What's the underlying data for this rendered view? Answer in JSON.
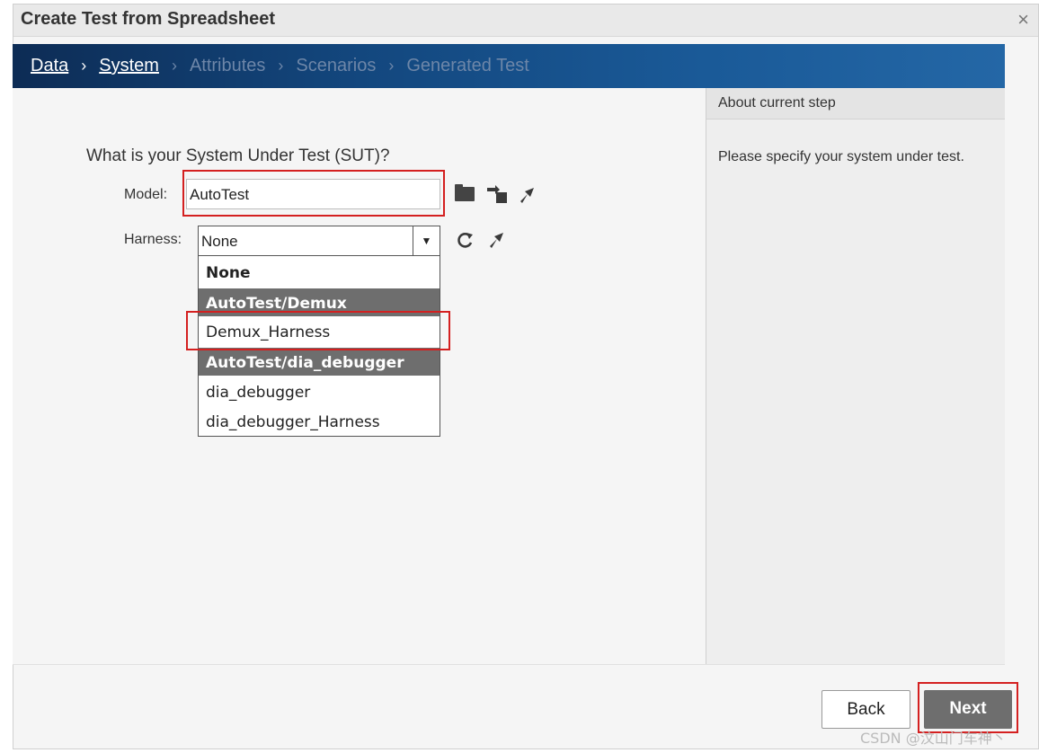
{
  "dialog": {
    "title": "Create Test from Spreadsheet",
    "close_symbol": "×"
  },
  "wizard": {
    "steps": [
      {
        "label": "Data",
        "state": "done"
      },
      {
        "label": "System",
        "state": "current"
      },
      {
        "label": "Attributes",
        "state": "pending"
      },
      {
        "label": "Scenarios",
        "state": "pending"
      },
      {
        "label": "Generated Test",
        "state": "pending"
      }
    ],
    "separator": "›"
  },
  "form": {
    "question": "What is your System Under Test (SUT)?",
    "model_label": "Model:",
    "model_value": "AutoTest",
    "harness_label": "Harness:",
    "harness_value": "None",
    "harness_options": [
      {
        "label": "None",
        "type": "option-bold"
      },
      {
        "label": "AutoTest/Demux",
        "type": "group"
      },
      {
        "label": "Demux_Harness",
        "type": "option"
      },
      {
        "label": "AutoTest/dia_debugger",
        "type": "group"
      },
      {
        "label": "dia_debugger",
        "type": "option"
      },
      {
        "label": "dia_debugger_Harness",
        "type": "option"
      }
    ],
    "icons": {
      "model": [
        "folder-open-icon",
        "highlight-model-icon",
        "navigate-to-model-icon"
      ],
      "harness": [
        "refresh-icon",
        "navigate-to-harness-icon"
      ]
    }
  },
  "side_panel": {
    "header": "About current step",
    "text": "Please specify your system under test."
  },
  "footer": {
    "back_label": "Back",
    "next_label": "Next"
  },
  "watermark": "CSDN @汶山门车神丶",
  "colors": {
    "highlight": "#d42020",
    "wizard_bar": "#13477e",
    "group_header": "#6e6e6e",
    "next_button": "#6e6e6e"
  }
}
